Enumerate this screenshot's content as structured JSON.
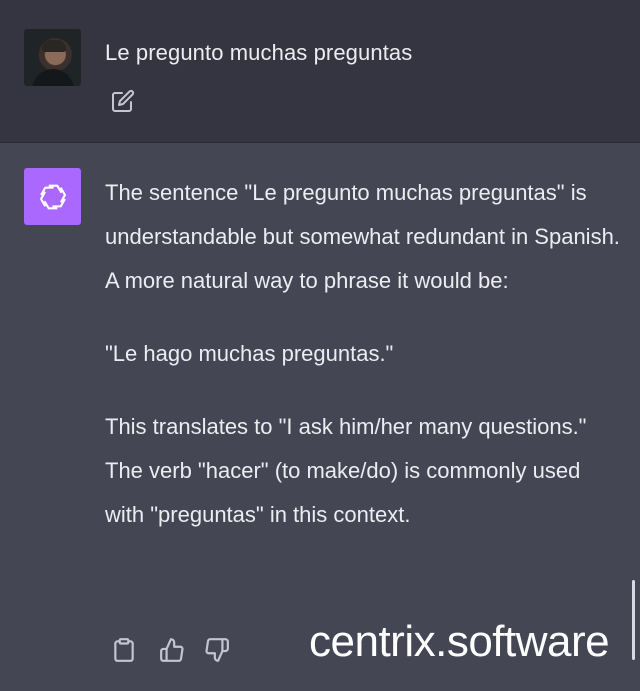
{
  "user_message": {
    "text": "Le pregunto muchas preguntas",
    "avatar": "user-avatar-photo",
    "edit_icon": "edit-icon"
  },
  "assistant_message": {
    "avatar_icon": "openai-logo-icon",
    "avatar_color": "#ab68ff",
    "paragraphs": [
      "The sentence \"Le pregunto muchas preguntas\" is understandable but somewhat redundant in Spanish. A more natural way to phrase it would be:",
      "\"Le hago muchas preguntas.\"",
      "This translates to \"I ask him/her many questions.\" The verb \"hacer\" (to make/do) is commonly used with \"preguntas\" in this context."
    ],
    "action_icons": [
      "copy-icon",
      "thumbs-up-icon",
      "thumbs-down-icon"
    ]
  },
  "watermark": "centrix.software",
  "colors": {
    "user_bg": "#343541",
    "assistant_bg": "#444654",
    "text": "#ececf1",
    "icon": "#c5c5d2"
  }
}
